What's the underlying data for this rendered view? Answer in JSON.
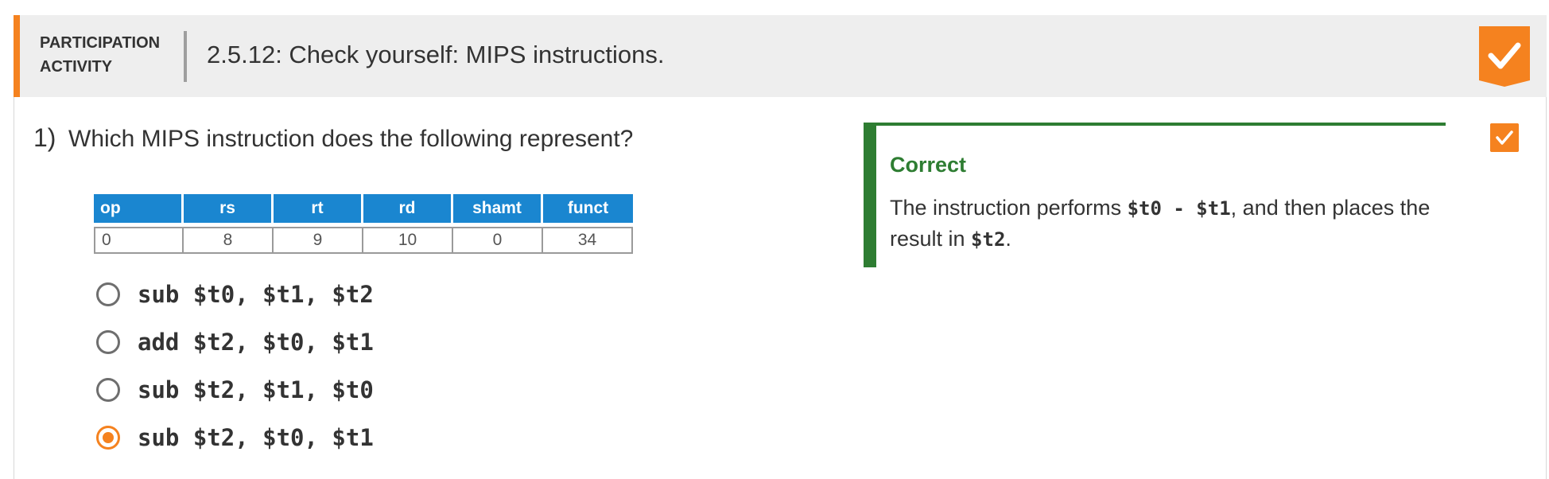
{
  "activity": {
    "label_line1": "PARTICIPATION",
    "label_line2": "ACTIVITY",
    "title": "2.5.12: Check yourself: MIPS instructions.",
    "completed": true,
    "accent_color": "#f5821f"
  },
  "question": {
    "number": "1)",
    "text": "Which MIPS instruction does the following represent?",
    "table": {
      "headers": [
        "op",
        "rs",
        "rt",
        "rd",
        "shamt",
        "funct"
      ],
      "values": [
        "0",
        "8",
        "9",
        "10",
        "0",
        "34"
      ]
    },
    "choices": [
      {
        "label": "sub $t0, $t1, $t2",
        "selected": false
      },
      {
        "label": "add $t2, $t0, $t1",
        "selected": false
      },
      {
        "label": "sub $t2, $t1, $t0",
        "selected": false
      },
      {
        "label": "sub $t2, $t0, $t1",
        "selected": true
      }
    ],
    "answered_correctly": true
  },
  "feedback": {
    "title": "Correct",
    "text_before": "The instruction performs ",
    "code1": "$t0 - $t1",
    "text_middle": ", and then places the result in ",
    "code2": "$t2",
    "text_after": ".",
    "color": "#2e7d32"
  }
}
